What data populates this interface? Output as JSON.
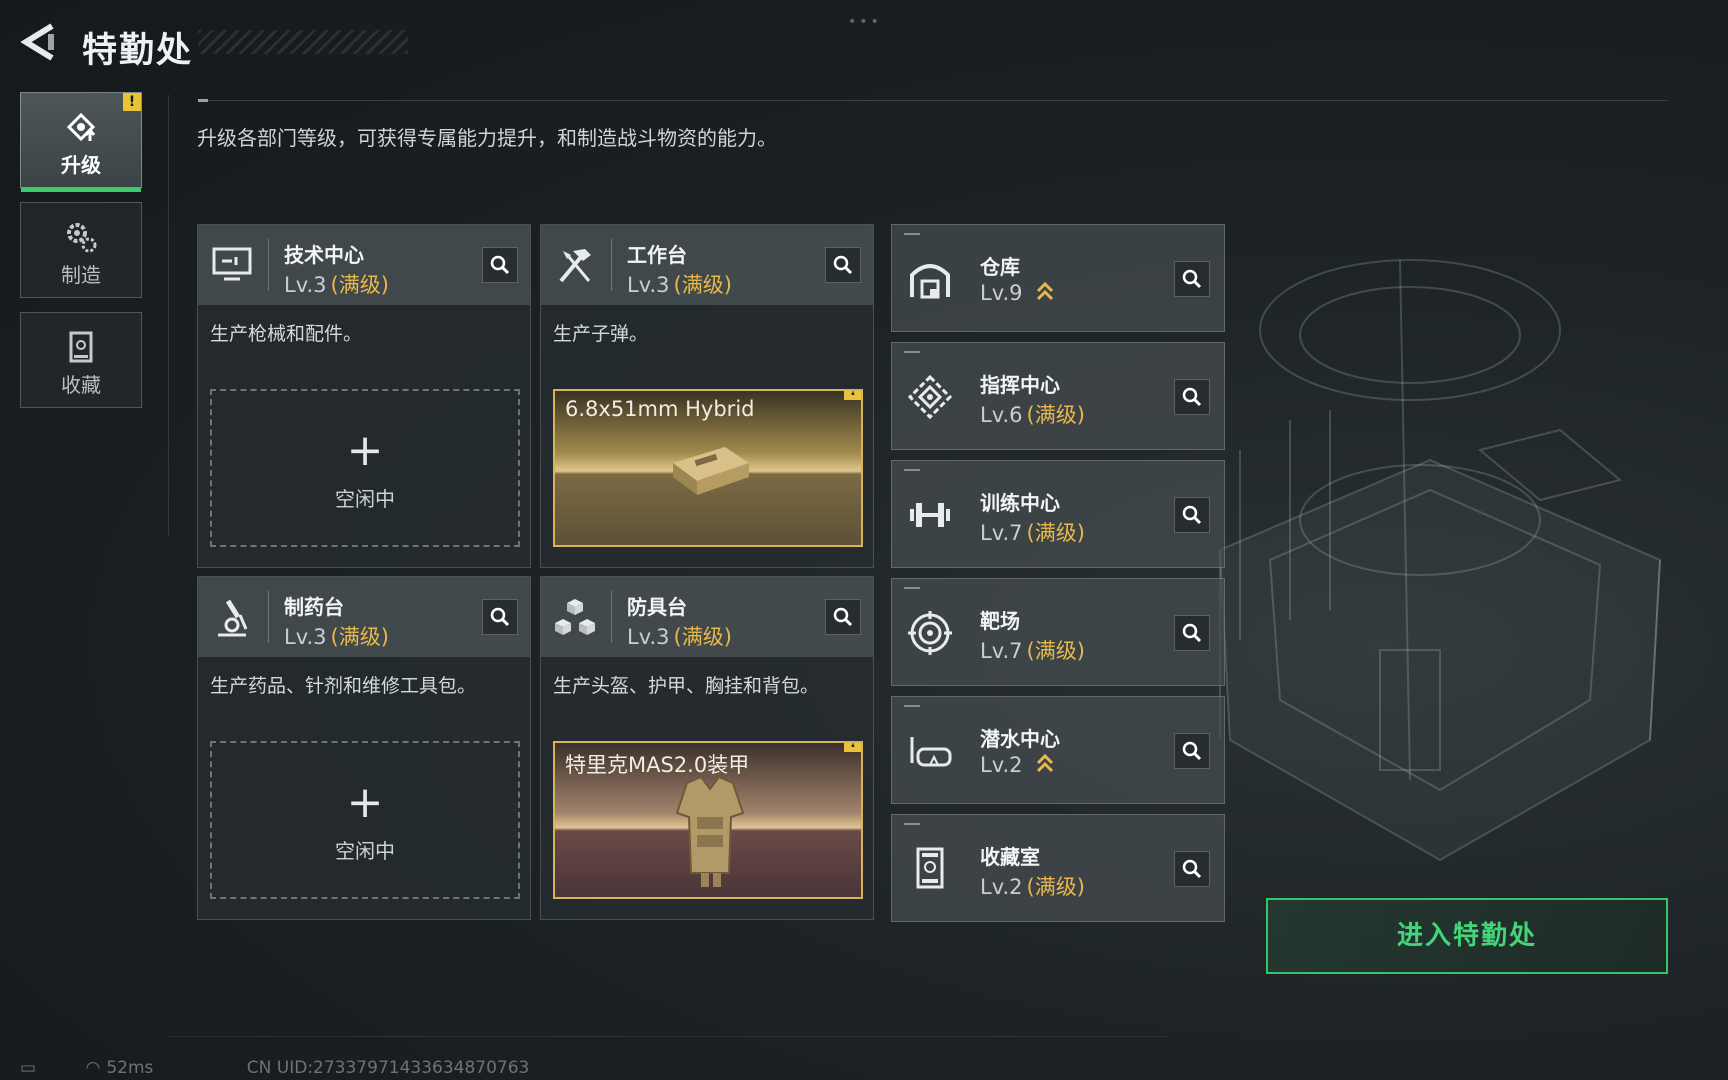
{
  "header": {
    "title": "特勤处"
  },
  "description": "升级各部门等级，可获得专属能力提升，和制造战斗物资的能力。",
  "nav": [
    {
      "label": "升级",
      "active": true,
      "alert": "!"
    },
    {
      "label": "制造",
      "active": false
    },
    {
      "label": "收藏",
      "active": false
    }
  ],
  "cards": [
    {
      "name": "技术中心",
      "level": "Lv.3",
      "max": "(满级)",
      "desc": "生产枪械和配件。",
      "slot": {
        "plus": "+",
        "status": "空闲中"
      }
    },
    {
      "name": "工作台",
      "level": "Lv.3",
      "max": "(满级)",
      "desc": "生产子弹。",
      "product": {
        "name": "6.8x51mm Hybrid",
        "alert": "!"
      }
    },
    {
      "name": "制药台",
      "level": "Lv.3",
      "max": "(满级)",
      "desc": "生产药品、针剂和维修工具包。",
      "slot": {
        "plus": "+",
        "status": "空闲中"
      }
    },
    {
      "name": "防具台",
      "level": "Lv.3",
      "max": "(满级)",
      "desc": "生产头盔、护甲、胸挂和背包。",
      "product": {
        "name": "特里克MAS2.0装甲",
        "alert": "!"
      }
    }
  ],
  "facilities": [
    {
      "name": "仓库",
      "level": "Lv.9",
      "max": "",
      "upgradable": true,
      "icon": "warehouse-icon"
    },
    {
      "name": "指挥中心",
      "level": "Lv.6",
      "max": "(满级)",
      "upgradable": false,
      "icon": "command-icon"
    },
    {
      "name": "训练中心",
      "level": "Lv.7",
      "max": "(满级)",
      "upgradable": false,
      "icon": "dumbbell-icon"
    },
    {
      "name": "靶场",
      "level": "Lv.7",
      "max": "(满级)",
      "upgradable": false,
      "icon": "target-icon"
    },
    {
      "name": "潜水中心",
      "level": "Lv.2",
      "max": "",
      "upgradable": true,
      "icon": "diving-mask-icon"
    },
    {
      "name": "收藏室",
      "level": "Lv.2",
      "max": "(满级)",
      "upgradable": false,
      "icon": "collection-icon"
    }
  ],
  "enter_button": "进入特勤处",
  "footer": {
    "ping": "52ms",
    "uid": "CN UID:27337971433634870763"
  },
  "colors": {
    "accent_green": "#3dcc6e",
    "max_gold": "#e8b94a",
    "alert_yellow": "#e9c437"
  }
}
